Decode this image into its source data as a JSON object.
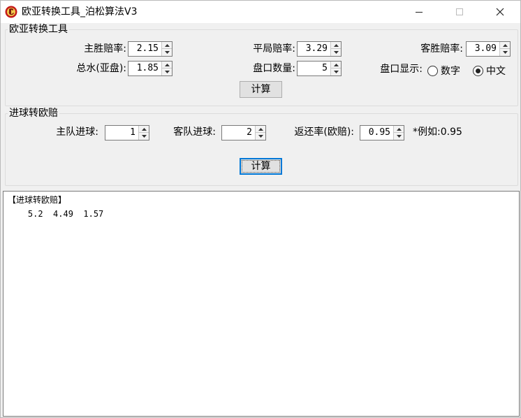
{
  "window": {
    "title": "欧亚转换工具_泊松算法V3",
    "minimize_glyph": "min-icon",
    "maximize_glyph": "max-icon",
    "close_glyph": "close-icon"
  },
  "euro_asia": {
    "group_title": "欧亚转换工具",
    "home_odds_label": "主胜赔率:",
    "home_odds_value": "2.15",
    "draw_odds_label": "平局赔率:",
    "draw_odds_value": "3.29",
    "away_odds_label": "客胜赔率:",
    "away_odds_value": "3.09",
    "water_label": "总水(亚盘):",
    "water_value": "1.85",
    "handicap_count_label": "盘口数量:",
    "handicap_count_value": "5",
    "display_label": "盘口显示:",
    "display_options": [
      {
        "label": "数字",
        "checked": false
      },
      {
        "label": "中文",
        "checked": true
      }
    ],
    "calc_label": "计算"
  },
  "goals_to_euro": {
    "group_title": "进球转欧赔",
    "home_goals_label": "主队进球:",
    "home_goals_value": "1",
    "away_goals_label": "客队进球:",
    "away_goals_value": "2",
    "return_rate_label": "返还率(欧赔):",
    "return_rate_value": "0.95",
    "example_text": "*例如:0.95",
    "calc_label": "计算"
  },
  "output": {
    "lines": [
      "【进球转欧赔】",
      "    5.2  4.49  1.57"
    ]
  },
  "colors": {
    "window_bg": "#f0f0f0",
    "focus_blue": "#0078d7",
    "button_bg": "#e1e1e1"
  }
}
